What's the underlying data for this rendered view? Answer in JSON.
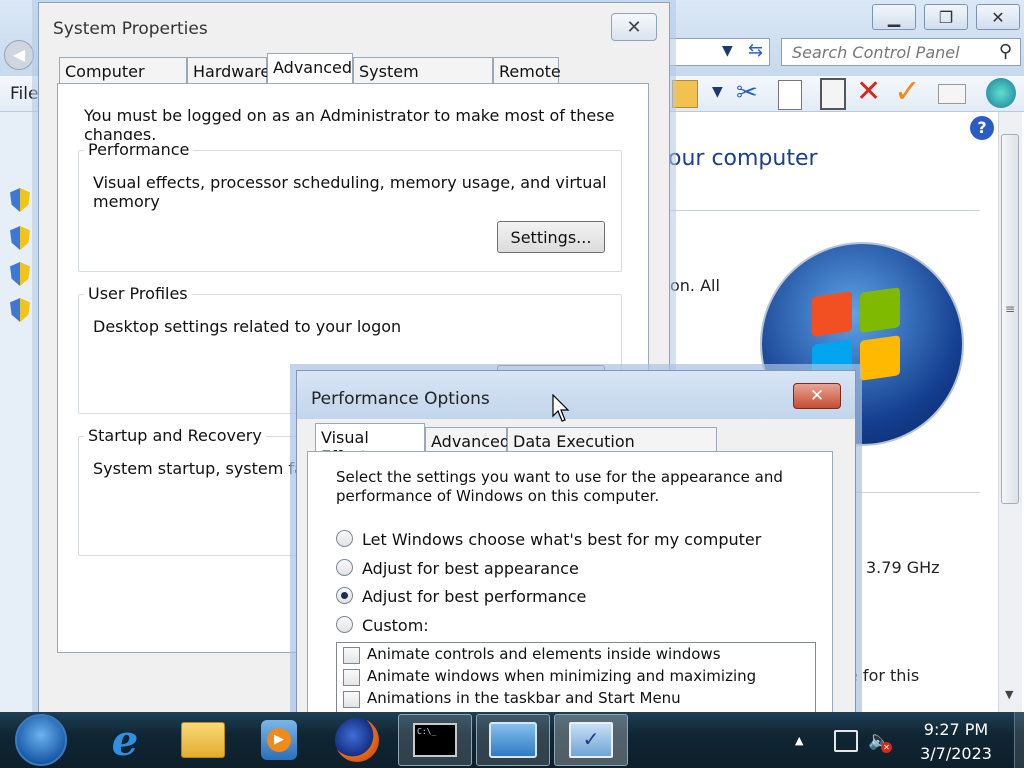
{
  "control_panel": {
    "search_placeholder": "Search Control Panel",
    "menu_file": "File",
    "title_fragment": "our computer",
    "text_fragment_1": "on.  All",
    "speed": "3.79 GHz",
    "text_fragment_2": "e for this",
    "window_buttons": [
      "minimize",
      "restore",
      "close"
    ]
  },
  "system_properties": {
    "title": "System Properties",
    "tabs": [
      "Computer Name",
      "Hardware",
      "Advanced",
      "System Protection",
      "Remote"
    ],
    "selected_tab": "Advanced",
    "admin_note": "You must be logged on as an Administrator to make most of these changes.",
    "performance": {
      "label": "Performance",
      "description": "Visual effects, processor scheduling, memory usage, and virtual memory",
      "button": "Settings..."
    },
    "user_profiles": {
      "label": "User Profiles",
      "description": "Desktop settings related to your logon"
    },
    "startup": {
      "label": "Startup and Recovery",
      "description": "System startup, system failur"
    }
  },
  "performance_options": {
    "title": "Performance Options",
    "tabs": [
      "Visual Effects",
      "Advanced",
      "Data Execution Prevention"
    ],
    "selected_tab": "Visual Effects",
    "intro_line1": "Select the settings you want to use for the appearance and",
    "intro_line2": "performance of Windows on this computer.",
    "options": [
      {
        "label": "Let Windows choose what's best for my computer",
        "selected": false
      },
      {
        "label": "Adjust for best appearance",
        "selected": false
      },
      {
        "label": "Adjust for best performance",
        "selected": true
      },
      {
        "label": "Custom:",
        "selected": false
      }
    ],
    "effects": [
      {
        "label": "Animate controls and elements inside windows",
        "checked": false
      },
      {
        "label": "Animate windows when minimizing and maximizing",
        "checked": false
      },
      {
        "label": "Animations in the taskbar and Start Menu",
        "checked": false
      }
    ]
  },
  "taskbar": {
    "time": "9:27 PM",
    "date": "3/7/2023",
    "apps": [
      "start-orb",
      "internet-explorer",
      "windows-explorer",
      "media-player",
      "firefox",
      "command-prompt",
      "control-panel",
      "system-properties"
    ]
  }
}
